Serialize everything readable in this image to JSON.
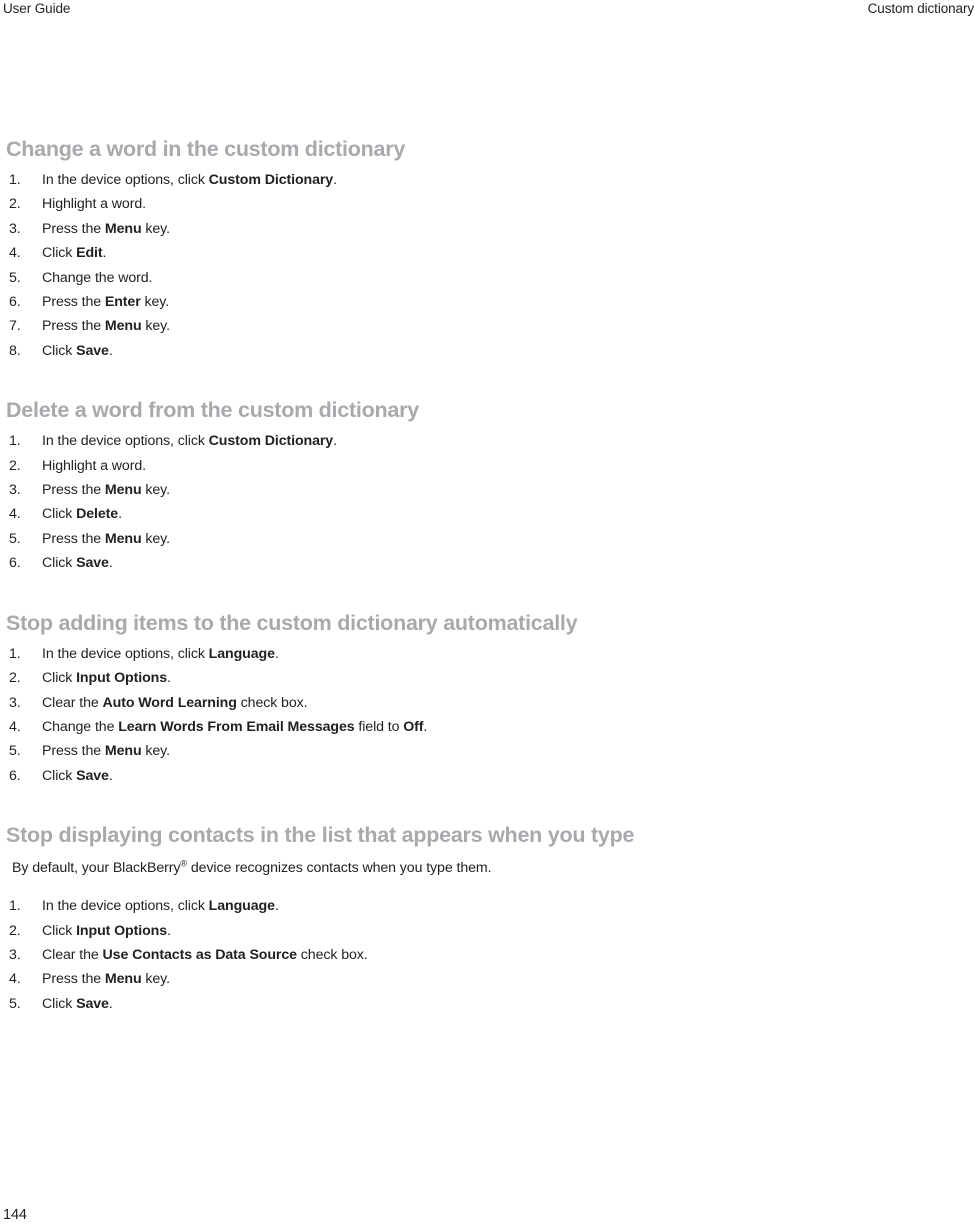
{
  "header": {
    "left": "User Guide",
    "right": "Custom dictionary"
  },
  "footer": {
    "page_number": "144"
  },
  "colors": {
    "heading": "#a7a9ac",
    "body_text": "#231f20",
    "background": "#ffffff"
  },
  "sections": [
    {
      "title": "Change a word in the custom dictionary",
      "intro": null,
      "steps": [
        {
          "html": "In the device options, click <b>Custom Dictionary</b>."
        },
        {
          "html": "Highlight a word."
        },
        {
          "html": "Press the <b>Menu</b> key."
        },
        {
          "html": "Click <b>Edit</b>."
        },
        {
          "html": "Change the word."
        },
        {
          "html": "Press the <b>Enter</b> key."
        },
        {
          "html": "Press the <b>Menu</b> key."
        },
        {
          "html": "Click <b>Save</b>."
        }
      ]
    },
    {
      "title": "Delete a word from the custom dictionary",
      "intro": null,
      "steps": [
        {
          "html": "In the device options, click <b>Custom Dictionary</b>."
        },
        {
          "html": "Highlight a word."
        },
        {
          "html": "Press the <b>Menu</b> key."
        },
        {
          "html": "Click <b>Delete</b>."
        },
        {
          "html": "Press the <b>Menu</b> key."
        },
        {
          "html": "Click <b>Save</b>."
        }
      ]
    },
    {
      "title": "Stop adding items to the custom dictionary automatically",
      "intro": null,
      "steps": [
        {
          "html": "In the device options, click <b>Language</b>."
        },
        {
          "html": "Click <b>Input Options</b>."
        },
        {
          "html": "Clear the <b>Auto Word Learning</b> check box."
        },
        {
          "html": "Change the <b>Learn Words From Email Messages</b> field to <b>Off</b>."
        },
        {
          "html": "Press the <b>Menu</b> key."
        },
        {
          "html": "Click <b>Save</b>."
        }
      ]
    },
    {
      "title": "Stop displaying contacts in the list that appears when you type",
      "intro": "By default, your BlackBerry<sup class=\"reg\">®</sup> device recognizes contacts when you type them.",
      "steps": [
        {
          "html": "In the device options, click <b>Language</b>."
        },
        {
          "html": "Click <b>Input Options</b>."
        },
        {
          "html": "Clear the <b>Use Contacts as Data Source</b> check box."
        },
        {
          "html": "Press the <b>Menu</b> key."
        },
        {
          "html": "Click <b>Save</b>."
        }
      ]
    }
  ]
}
